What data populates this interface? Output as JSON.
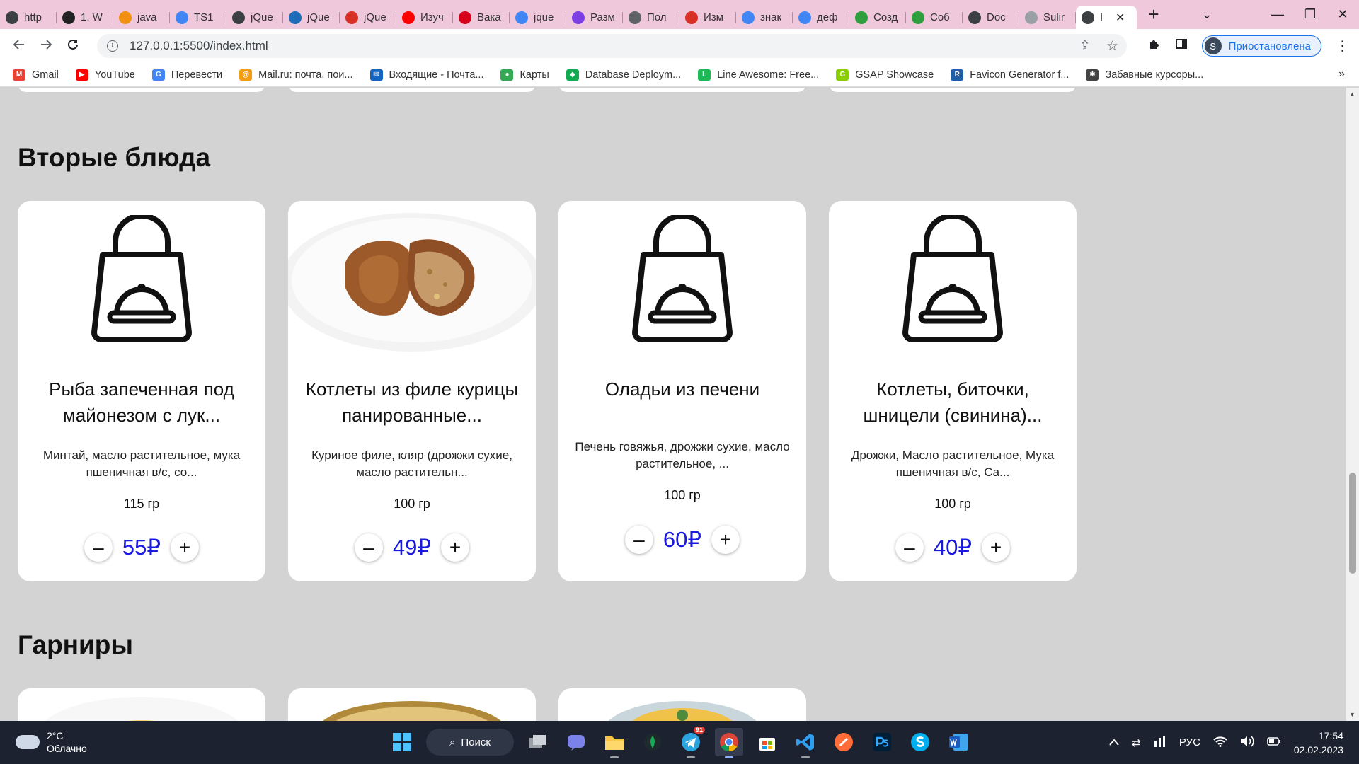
{
  "tabs": [
    {
      "title": "http",
      "icon": "globe-icon",
      "color": "#3c4043"
    },
    {
      "title": "1. W",
      "icon": "spy-icon",
      "color": "#222222"
    },
    {
      "title": "java",
      "icon": "code-icon",
      "color": "#f29111"
    },
    {
      "title": "TS1",
      "icon": "google-icon",
      "color": "#4285f4"
    },
    {
      "title": "jQue",
      "icon": "globe-icon",
      "color": "#3c4043"
    },
    {
      "title": "jQue",
      "icon": "docs-icon",
      "color": "#1e6bb8"
    },
    {
      "title": "jQue",
      "icon": "code-brackets-icon",
      "color": "#d93025"
    },
    {
      "title": "Изуч",
      "icon": "youtube-icon",
      "color": "#ff0000"
    },
    {
      "title": "Вака",
      "icon": "hh-icon",
      "color": "#d6001c"
    },
    {
      "title": "jque",
      "icon": "google-icon",
      "color": "#4285f4"
    },
    {
      "title": "Разм",
      "icon": "arrows-icon",
      "color": "#7b3fe4"
    },
    {
      "title": "Пол",
      "icon": "mail-icon",
      "color": "#5f6368"
    },
    {
      "title": "Изм",
      "icon": "tower-icon",
      "color": "#d93025"
    },
    {
      "title": "знак",
      "icon": "google-icon",
      "color": "#4285f4"
    },
    {
      "title": "деф",
      "icon": "google-icon",
      "color": "#4285f4"
    },
    {
      "title": "Созд",
      "icon": "leaf-icon",
      "color": "#2e9e3f"
    },
    {
      "title": "Соб",
      "icon": "leaf-icon",
      "color": "#2e9e3f"
    },
    {
      "title": "Doc",
      "icon": "globe-icon",
      "color": "#3c4043"
    },
    {
      "title": "Sulir",
      "icon": "github-icon",
      "color": "#9aa0a6"
    },
    {
      "title": "I",
      "icon": "globe-icon",
      "color": "#3c4043",
      "active": true
    }
  ],
  "tab_close": "✕",
  "newtab": "+",
  "window": {
    "tabsearch": "⌄",
    "minimize": "—",
    "restore": "❐",
    "close": "✕"
  },
  "toolbar": {
    "url": "127.0.0.1:5500/index.html",
    "profile_initial": "S",
    "profile_label": "Приостановлена"
  },
  "bookmarks": [
    {
      "label": "Gmail",
      "icon": "gmail-icon",
      "color": "#ea4335",
      "glyph": "M"
    },
    {
      "label": "YouTube",
      "icon": "youtube-icon",
      "color": "#ff0000",
      "glyph": "▶"
    },
    {
      "label": "Перевести",
      "icon": "translate-icon",
      "color": "#4285f4",
      "glyph": "G"
    },
    {
      "label": "Mail.ru: почта, пои...",
      "icon": "mailru-icon",
      "color": "#f39c12",
      "glyph": "@"
    },
    {
      "label": "Входящие - Почта...",
      "icon": "inbox-icon",
      "color": "#1565c0",
      "glyph": "✉"
    },
    {
      "label": "Карты",
      "icon": "maps-pin-icon",
      "color": "#34a853",
      "glyph": "●"
    },
    {
      "label": "Database Deploym...",
      "icon": "mongodb-icon",
      "color": "#13aa52",
      "glyph": "◆"
    },
    {
      "label": "Line Awesome: Free...",
      "icon": "line-awesome-icon",
      "color": "#1db954",
      "glyph": "L"
    },
    {
      "label": "GSAP Showcase",
      "icon": "gsap-icon",
      "color": "#88ce02",
      "glyph": "G"
    },
    {
      "label": "Favicon Generator f...",
      "icon": "favicon-generator-icon",
      "color": "#1e5fa8",
      "glyph": "R"
    },
    {
      "label": "Забавные курсоры...",
      "icon": "cursor-icon",
      "color": "#444444",
      "glyph": "✱"
    }
  ],
  "sections": {
    "main": {
      "title": "Вторые блюда"
    },
    "garnish": {
      "title": "Гарниры"
    }
  },
  "cards": [
    {
      "name": "Рыба запеченная под майонезом с лук...",
      "desc": "Минтай, масло растительное, мука пшеничная в/с, со...",
      "weight": "115 гр",
      "price": "55₽",
      "image": "bag-placeholder"
    },
    {
      "name": "Котлеты из филе курицы панированные...",
      "desc": "Куриное филе, кляр (дрожжи сухие, масло растительн...",
      "weight": "100 гр",
      "price": "49₽",
      "image": "cutlet-photo"
    },
    {
      "name": "Оладьи из печени",
      "desc": "Печень говяжья, дрожжи сухие, масло растительное, ...",
      "weight": "100 гр",
      "price": "60₽",
      "image": "bag-placeholder"
    },
    {
      "name": "Котлеты, биточки, шницели (свинина)...",
      "desc": "Дрожжи, Масло растительное, Мука пшеничная в/с, Са...",
      "weight": "100 гр",
      "price": "40₽",
      "image": "bag-placeholder"
    }
  ],
  "qty": {
    "minus": "–",
    "plus": "+"
  },
  "taskbar": {
    "temp": "2°C",
    "weather": "Облачно",
    "search": "Поиск",
    "lang": "РУС",
    "time": "17:54",
    "date": "02.02.2023",
    "telegram_badge": "91"
  },
  "colors": {
    "accent_price": "#1a1adf",
    "tabstrip": "#f0c8dc",
    "page_bg": "#d3d3d3"
  }
}
